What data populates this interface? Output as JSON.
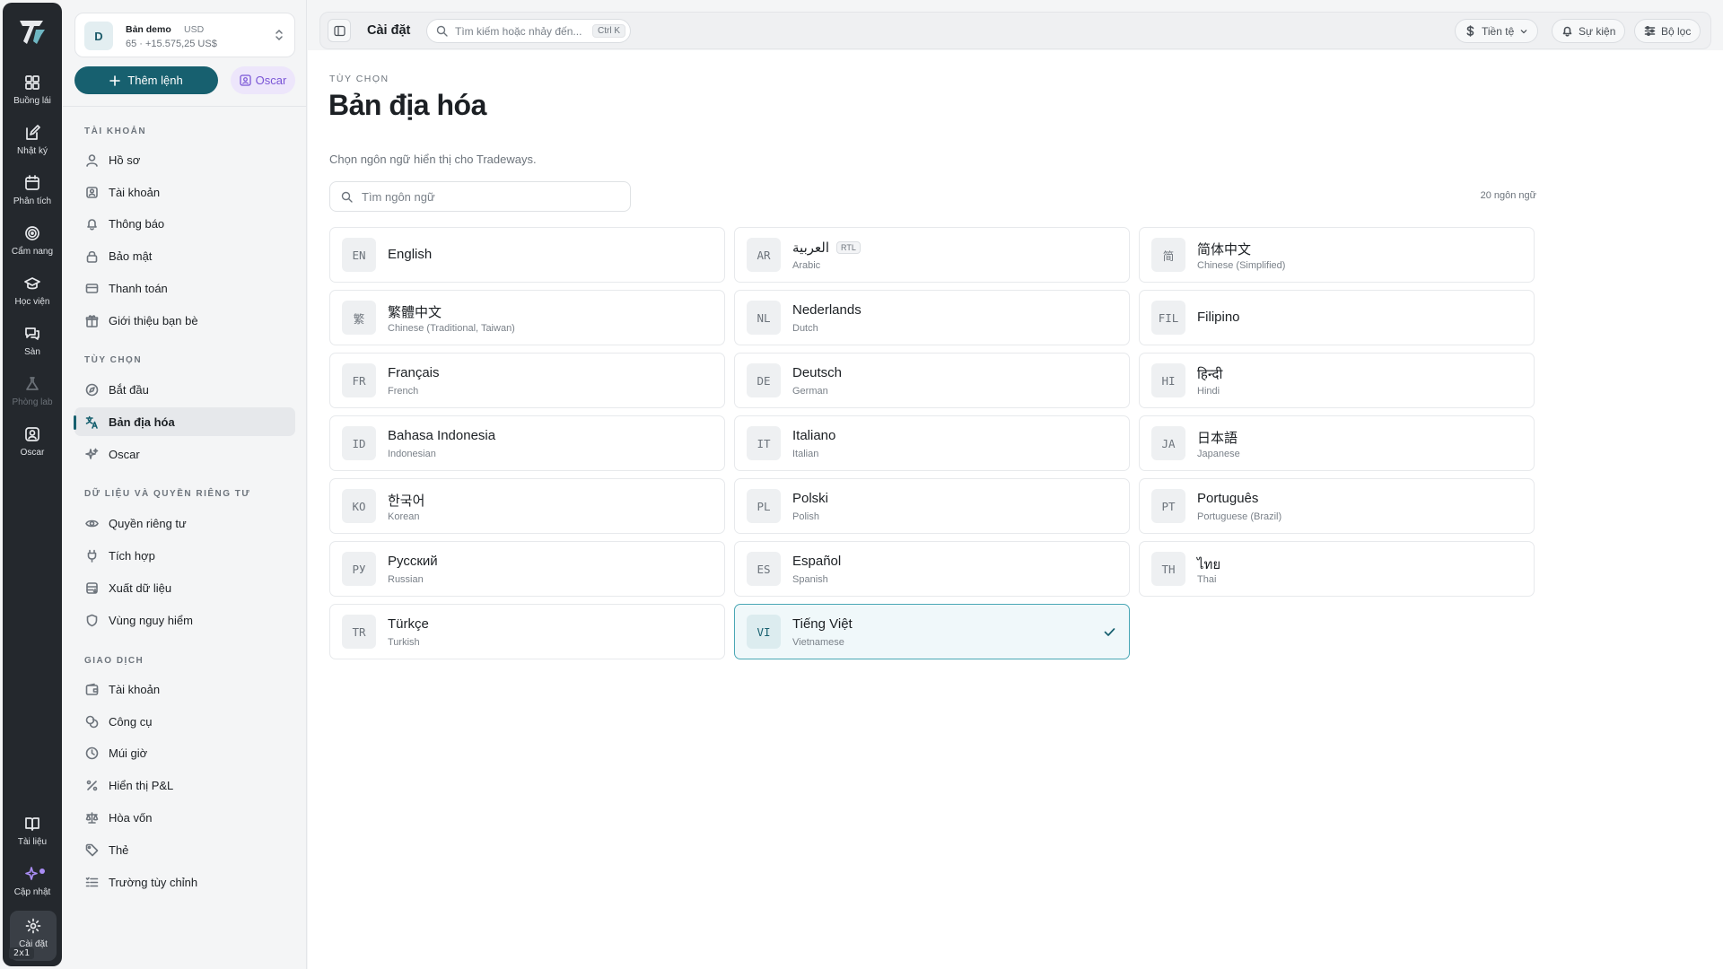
{
  "rail": {
    "items": [
      {
        "label": "Buồng lái",
        "icon": "dashboard-icon"
      },
      {
        "label": "Nhật ký",
        "icon": "journal-icon"
      },
      {
        "label": "Phân tích",
        "icon": "analytics-icon"
      },
      {
        "label": "Cẩm nang",
        "icon": "playbook-icon"
      },
      {
        "label": "Học viện",
        "icon": "academy-icon"
      },
      {
        "label": "Sàn",
        "icon": "chat-icon"
      },
      {
        "label": "Phòng lab",
        "icon": "flask-icon"
      },
      {
        "label": "Oscar",
        "icon": "oscar-icon"
      }
    ],
    "bottom": [
      {
        "label": "Tài liệu",
        "icon": "book-icon"
      },
      {
        "label": "Cập nhật",
        "icon": "sparkle-icon"
      },
      {
        "label": "Cài đặt",
        "icon": "gear-icon"
      }
    ],
    "zoom_badge": "2x1"
  },
  "account": {
    "avatar": "D",
    "name": "Bản demo",
    "currency": "USD",
    "summary": "65 · +15.575,25 US$"
  },
  "actions": {
    "add_order": "Thêm lệnh",
    "oscar": "Oscar"
  },
  "sidebar": {
    "sections": [
      {
        "title": "Tài khoản",
        "items": [
          "Hồ sơ",
          "Tài khoản",
          "Thông báo",
          "Bảo mật",
          "Thanh toán",
          "Giới thiệu bạn bè"
        ]
      },
      {
        "title": "Tùy chọn",
        "items": [
          "Bắt đầu",
          "Bản địa hóa",
          "Oscar"
        ]
      },
      {
        "title": "Dữ liệu và quyền riêng tư",
        "items": [
          "Quyền riêng tư",
          "Tích hợp",
          "Xuất dữ liệu",
          "Vùng nguy hiểm"
        ]
      },
      {
        "title": "Giao dịch",
        "items": [
          "Tài khoản",
          "Công cụ",
          "Múi giờ",
          "Hiển thị P&L",
          "Hòa vốn",
          "Thẻ",
          "Trường tùy chỉnh"
        ]
      }
    ],
    "active_item": "Bản địa hóa"
  },
  "topbar": {
    "title": "Cài đặt",
    "search_placeholder": "Tìm kiếm hoặc nhảy đến...",
    "search_shortcut": "Ctrl K",
    "currency_btn": "Tiền tệ",
    "events_btn": "Sự kiện",
    "filter_btn": "Bộ lọc"
  },
  "page": {
    "eyebrow": "Tùy chọn",
    "title": "Bản địa hóa",
    "description": "Chọn ngôn ngữ hiển thị cho Tradeways.",
    "search_placeholder": "Tìm ngôn ngữ",
    "count": "20 ngôn ngữ"
  },
  "languages": [
    {
      "code": "EN",
      "native": "English",
      "english": ""
    },
    {
      "code": "AR",
      "native": "العربية",
      "english": "Arabic",
      "badge": "RTL"
    },
    {
      "code": "简",
      "native": "简体中文",
      "english": "Chinese (Simplified)"
    },
    {
      "code": "繁",
      "native": "繁體中文",
      "english": "Chinese (Traditional, Taiwan)"
    },
    {
      "code": "NL",
      "native": "Nederlands",
      "english": "Dutch"
    },
    {
      "code": "FIL",
      "native": "Filipino",
      "english": ""
    },
    {
      "code": "FR",
      "native": "Français",
      "english": "French"
    },
    {
      "code": "DE",
      "native": "Deutsch",
      "english": "German"
    },
    {
      "code": "HI",
      "native": "हिन्दी",
      "english": "Hindi"
    },
    {
      "code": "ID",
      "native": "Bahasa Indonesia",
      "english": "Indonesian"
    },
    {
      "code": "IT",
      "native": "Italiano",
      "english": "Italian"
    },
    {
      "code": "JA",
      "native": "日本語",
      "english": "Japanese"
    },
    {
      "code": "KO",
      "native": "한국어",
      "english": "Korean"
    },
    {
      "code": "PL",
      "native": "Polski",
      "english": "Polish"
    },
    {
      "code": "PT",
      "native": "Português",
      "english": "Portuguese (Brazil)"
    },
    {
      "code": "РУ",
      "native": "Русский",
      "english": "Russian"
    },
    {
      "code": "ES",
      "native": "Español",
      "english": "Spanish"
    },
    {
      "code": "TH",
      "native": "ไทย",
      "english": "Thai"
    },
    {
      "code": "TR",
      "native": "Türkçe",
      "english": "Turkish"
    },
    {
      "code": "VI",
      "native": "Tiếng Việt",
      "english": "Vietnamese",
      "selected": true
    }
  ],
  "colors": {
    "accent": "#17606f",
    "rail_bg": "#24282d",
    "selected_border": "#4aa7b5",
    "oscar_purple": "#7a55d6"
  }
}
